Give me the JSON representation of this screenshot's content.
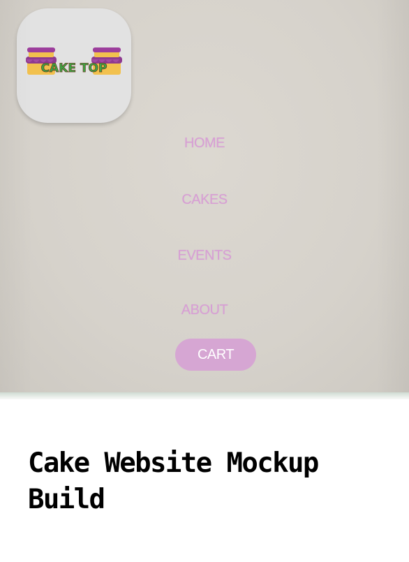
{
  "preview": {
    "logo": {
      "text": "CAKE TOP",
      "icon": "cake-top-logo"
    },
    "nav": [
      {
        "label": "HOME"
      },
      {
        "label": "CAKES"
      },
      {
        "label": "EVENTS"
      },
      {
        "label": "ABOUT"
      }
    ],
    "cart_label": "CART",
    "colors": {
      "background": "#d9d5ce",
      "nav_text": "#d79fd4",
      "cart_bg": "#d6a6d3",
      "logo_tile": "#e2e2e2"
    }
  },
  "caption": {
    "title": "Cake Website Mockup Build"
  }
}
